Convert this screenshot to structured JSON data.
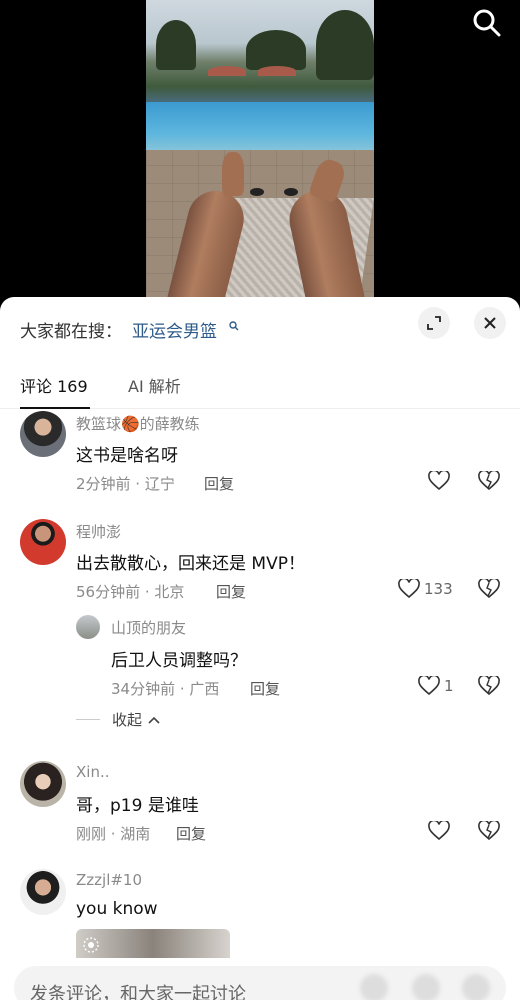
{
  "search_hint": {
    "prefix": "大家都在搜：",
    "keyword": "亚运会男篮"
  },
  "tabs": [
    {
      "label": "评论 169",
      "active": true
    },
    {
      "label": "AI 解析",
      "active": false
    }
  ],
  "comments": [
    {
      "user": "教篮球🏀的薛教练",
      "text": "这书是啥名呀",
      "meta": "2分钟前 · 辽宁",
      "reply_label": "回复",
      "likes": ""
    },
    {
      "user": "程帅澎",
      "text": "出去散散心，回来还是 MVP！",
      "meta": "56分钟前 · 北京",
      "reply_label": "回复",
      "likes": "133",
      "replies": [
        {
          "user": "山顶的朋友",
          "text": "后卫人员调整吗？",
          "meta": "34分钟前 · 广西",
          "reply_label": "回复",
          "likes": "1"
        }
      ],
      "collapse_label": "收起"
    },
    {
      "user": "Xin..",
      "text": "哥，p19 是谁哇",
      "meta": "刚刚 · 湖南",
      "reply_label": "回复",
      "likes": ""
    },
    {
      "user": "Zzzjl#10",
      "text": "you know",
      "meta": "",
      "reply_label": "",
      "likes": ""
    }
  ],
  "composer": {
    "placeholder": "发条评论，和大家一起讨论"
  },
  "colors": {
    "link": "#2e5b8a",
    "muted": "#8a8a8a"
  },
  "icons": [
    "search-icon",
    "expand-icon",
    "close-icon",
    "heart-icon",
    "broken-heart-icon",
    "chevron-up-icon"
  ]
}
